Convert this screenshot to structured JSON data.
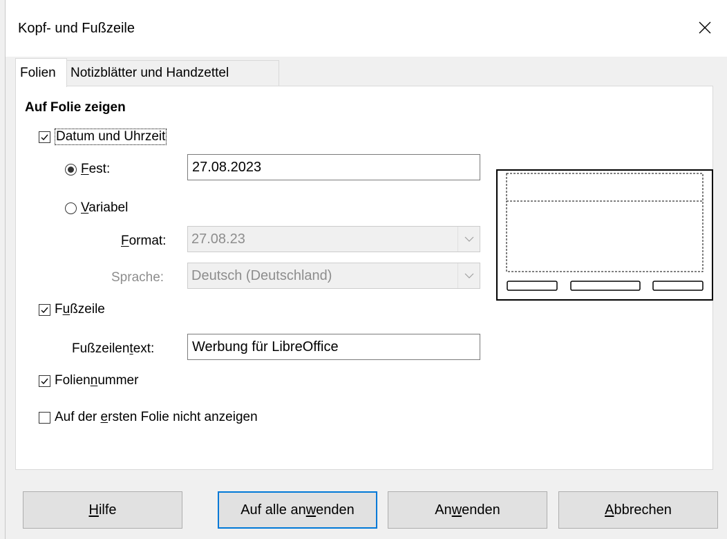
{
  "window": {
    "title": "Kopf- und Fußzeile",
    "close_glyph": "✕"
  },
  "tabs": [
    {
      "label": "Folien",
      "active": true
    },
    {
      "label": "Notizblätter und Handzettel",
      "active": false
    }
  ],
  "section": {
    "title": "Auf Folie zeigen"
  },
  "date_time": {
    "label_pre": "",
    "label_mnemonic": "",
    "label_post": "Datum und Uhrzeit",
    "checked": true,
    "fixed": {
      "label_mnemonic": "F",
      "label_post": "est:",
      "selected": true,
      "value": "27.08.2023"
    },
    "variable": {
      "label_mnemonic": "V",
      "label_post": "ariabel",
      "selected": false
    },
    "format": {
      "label_mnemonic": "F",
      "label_post": "ormat:",
      "value": "27.08.23",
      "enabled": false
    },
    "language": {
      "label": "Sprache:",
      "value": "Deutsch (Deutschland)",
      "enabled": false
    }
  },
  "footer": {
    "label_pre": "F",
    "label_mnemonic": "u",
    "label_post": "ßzeile",
    "checked": true,
    "text_label_pre": "Fußzeilen",
    "text_label_mnemonic": "t",
    "text_label_post": "ext:",
    "text_value": "Werbung für LibreOffice"
  },
  "slide_number": {
    "label_pre": "Folien",
    "label_mnemonic": "n",
    "label_post": "ummer",
    "checked": true
  },
  "hide_first": {
    "label_pre": "Auf der ",
    "label_mnemonic": "e",
    "label_post": "rsten Folie nicht anzeigen",
    "checked": false
  },
  "buttons": {
    "help": {
      "mnemonic": "H",
      "post": "ilfe"
    },
    "apply_all": {
      "pre": "Auf alle an",
      "mnemonic": "w",
      "post": "enden"
    },
    "apply": {
      "pre": "An",
      "mnemonic": "w",
      "post": "enden"
    },
    "cancel": {
      "mnemonic": "A",
      "post": "bbrechen"
    }
  },
  "colors": {
    "accent": "#0078d7",
    "disabled_text": "#8d8d8d"
  }
}
